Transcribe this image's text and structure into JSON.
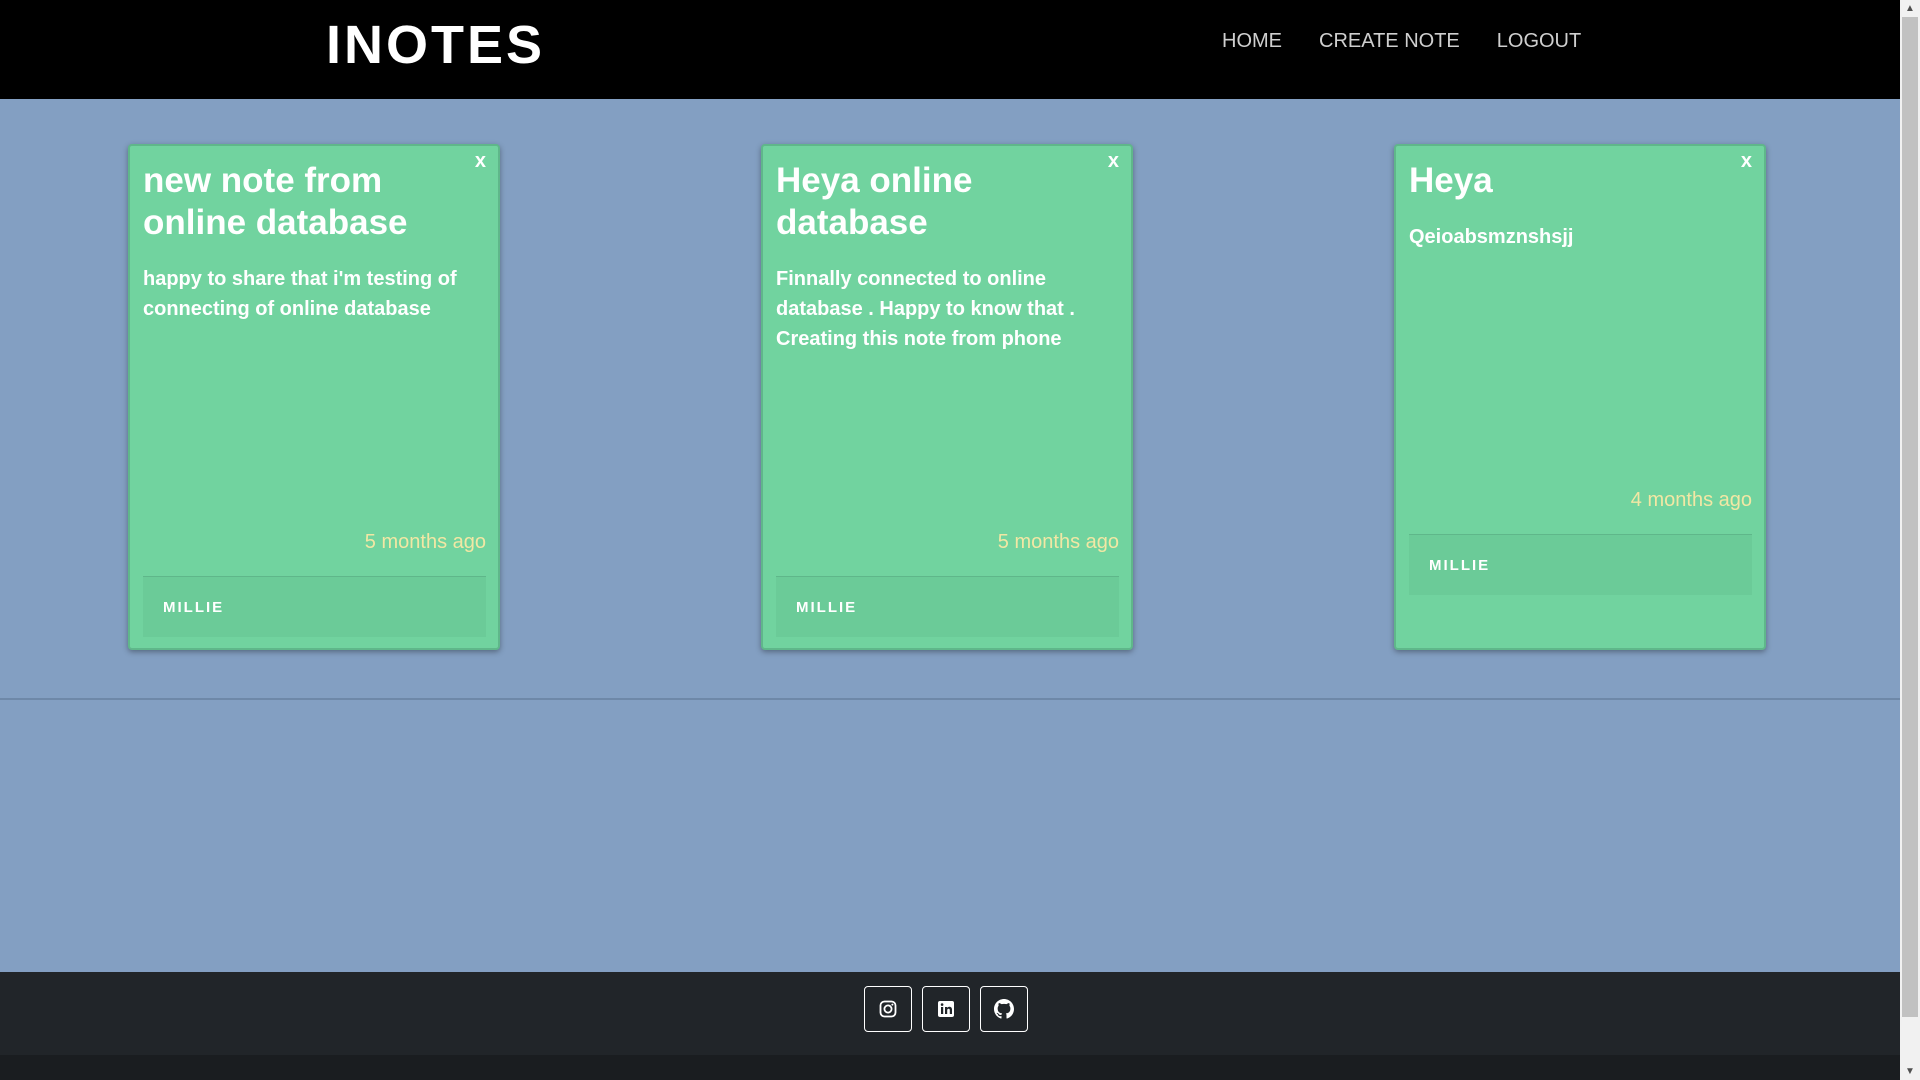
{
  "header": {
    "brand": "INOTES",
    "nav": [
      {
        "label": "HOME"
      },
      {
        "label": "CREATE NOTE"
      },
      {
        "label": "LOGOUT"
      }
    ]
  },
  "notes": [
    {
      "close": "x",
      "title": "new note from online database",
      "body": "happy to share that i'm testing of connecting of online database",
      "time": "5 months ago",
      "author": "MILLIE"
    },
    {
      "close": "x",
      "title": "Heya online database",
      "body": "Finnally connected to online database . Happy to know that . Creating this note from phone",
      "time": "5 months ago",
      "author": "MILLIE"
    },
    {
      "close": "x",
      "title": "Heya",
      "body": "Qeioabsmznshsjj",
      "time": "4 months ago",
      "author": "MILLIE"
    }
  ],
  "footer": {
    "social": [
      {
        "icon": "instagram-icon"
      },
      {
        "icon": "linkedin-icon"
      },
      {
        "icon": "github-icon"
      }
    ]
  },
  "colors": {
    "navbar": "#000000",
    "page_background": "#839fc2",
    "card": "#71d39f",
    "timestamp": "#f2e7a4",
    "footer": "#212529"
  }
}
